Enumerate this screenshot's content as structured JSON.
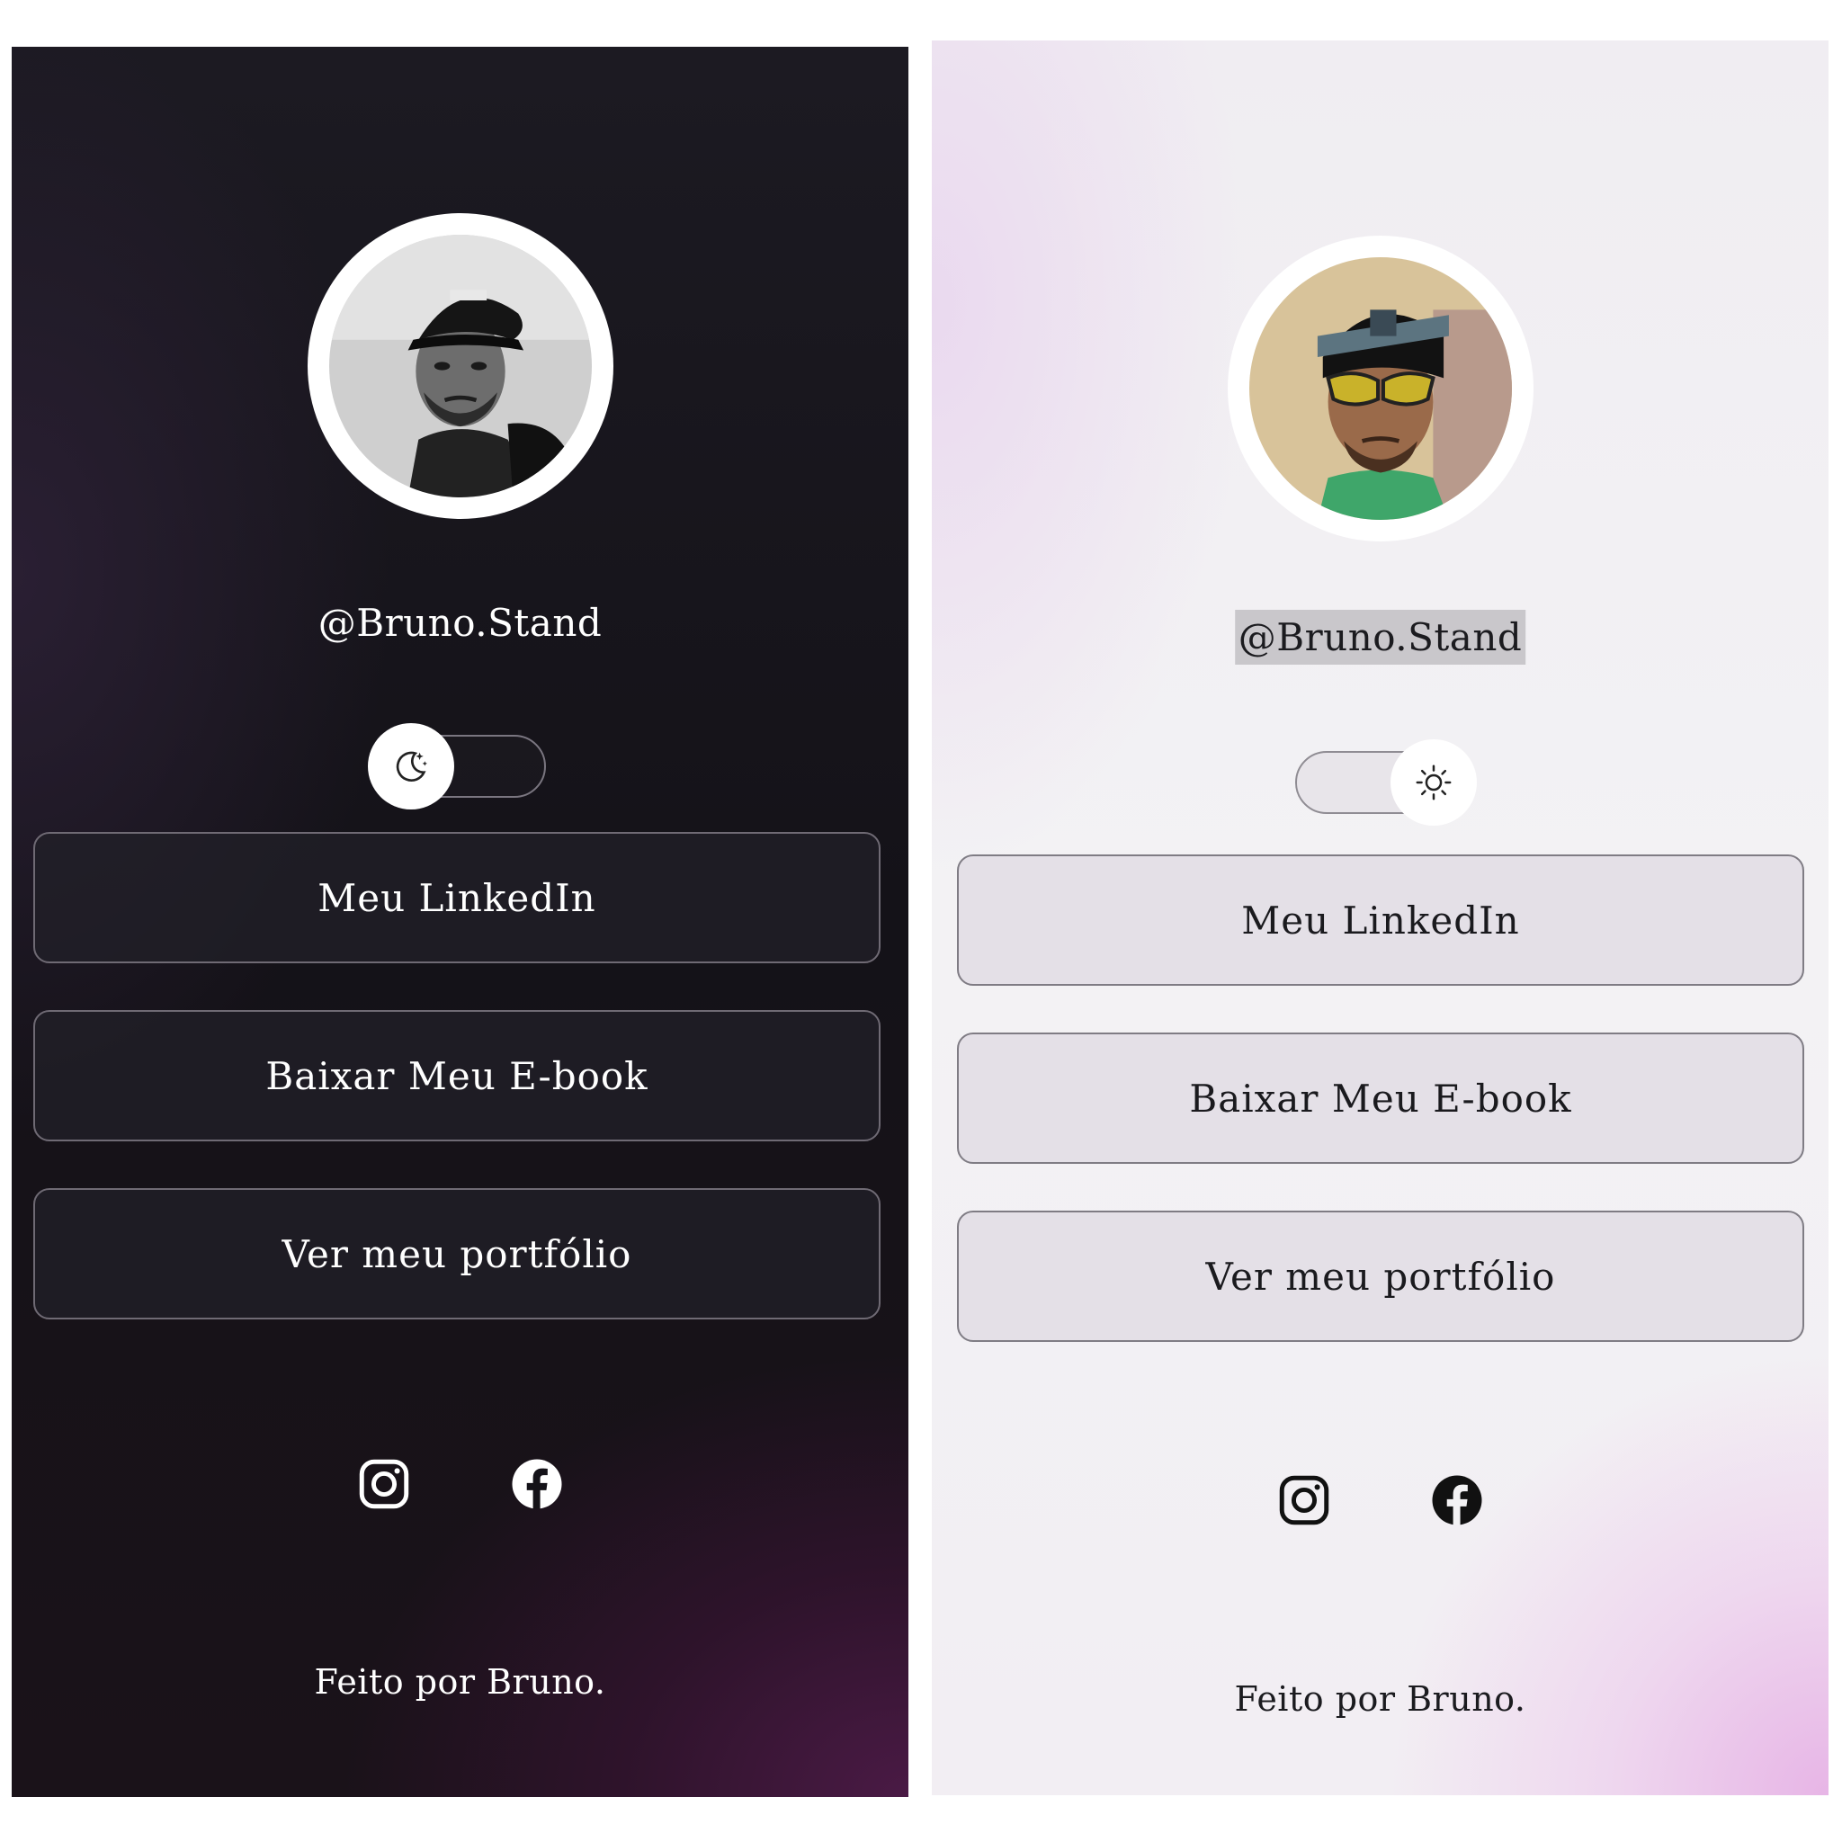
{
  "dark_view": {
    "theme": "dark",
    "profile": {
      "handle": "@Bruno.Stand",
      "avatar_icon": "person-grayscale-photo"
    },
    "theme_toggle": {
      "state": "dark",
      "knob_icon": "moon-stars-icon"
    },
    "links": [
      {
        "label": "Meu LinkedIn"
      },
      {
        "label": "Baixar Meu E-book"
      },
      {
        "label": "Ver meu portfólio"
      }
    ],
    "socials": [
      {
        "icon": "instagram-icon"
      },
      {
        "icon": "facebook-icon"
      }
    ],
    "footer": "Feito por Bruno.",
    "colors": {
      "background": "#141218",
      "accent_glow": "#4a1a45",
      "text": "#ffffff"
    }
  },
  "light_view": {
    "theme": "light",
    "profile": {
      "handle": "@Bruno.Stand",
      "avatar_icon": "person-color-photo"
    },
    "theme_toggle": {
      "state": "light",
      "knob_icon": "sun-icon"
    },
    "links": [
      {
        "label": "Meu LinkedIn"
      },
      {
        "label": "Baixar Meu E-book"
      },
      {
        "label": "Ver meu portfólio"
      }
    ],
    "socials": [
      {
        "icon": "instagram-icon"
      },
      {
        "icon": "facebook-icon"
      }
    ],
    "footer": "Feito por Bruno.",
    "colors": {
      "background": "#f3f2f4",
      "accent_glow": "#e7b5e6",
      "text": "#1b1b1f"
    }
  }
}
